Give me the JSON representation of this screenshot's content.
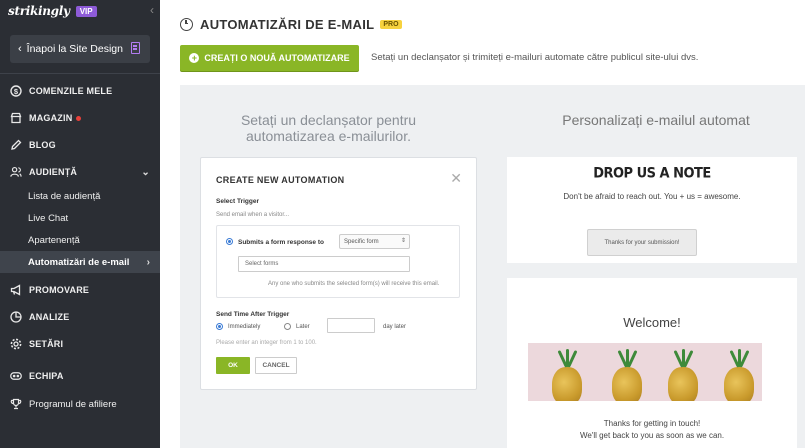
{
  "sidebar": {
    "logo": "strikingly",
    "badge": "VIP",
    "back_label": "Înapoi la Site Design",
    "items": [
      {
        "label": "COMENZILE MELE"
      },
      {
        "label": "MAGAZIN"
      },
      {
        "label": "BLOG"
      },
      {
        "label": "AUDIENȚĂ"
      },
      {
        "label": "Lista de audiență"
      },
      {
        "label": "Live Chat"
      },
      {
        "label": "Apartenență"
      },
      {
        "label": "Automatizări de e-mail"
      },
      {
        "label": "PROMOVARE"
      },
      {
        "label": "ANALIZE"
      },
      {
        "label": "SETĂRI"
      },
      {
        "label": "ECHIPA"
      },
      {
        "label": "Programul de afiliere"
      }
    ]
  },
  "header": {
    "title": "AUTOMATIZĂRI DE E-MAIL",
    "badge": "PRO"
  },
  "toolbar": {
    "create_label": "CREAȚI O NOUĂ AUTOMATIZARE",
    "description": "Setați un declanșator și trimiteți e-mailuri automate către publicul site-ului dvs."
  },
  "left_panel": {
    "heading": "Setați un declanșator pentru automatizarea e-mailurilor."
  },
  "modal": {
    "title": "CREATE NEW AUTOMATION",
    "select_trigger_label": "Select Trigger",
    "send_when_hint": "Send email when a visitor...",
    "form_response_label": "Submits a form response to",
    "select_value": "Specific form",
    "forms_placeholder": "Select forms",
    "forms_hint": "Any one who submits the selected form(s) will receive this email.",
    "send_time_label": "Send Time After Trigger",
    "immediately_label": "Immediately",
    "later_label": "Later",
    "days_later_label": "day later",
    "integer_hint": "Please enter an integer from 1 to 100.",
    "ok_label": "OK",
    "cancel_label": "CANCEL"
  },
  "right_panel": {
    "heading": "Personalizați e-mailul automat",
    "card1": {
      "title": "DROP US A NOTE",
      "subtitle": "Don't be afraid to reach out. You + us = awesome.",
      "button": "Thanks for your submission!"
    },
    "card2": {
      "title": "Welcome!",
      "line1": "Thanks for getting in touch!",
      "line2": "We'll get back to you as soon as we can."
    }
  },
  "colors": {
    "sidebar_bg": "#2b2e34",
    "accent_green": "#8ab626",
    "vip_purple": "#8e5bd8",
    "pro_yellow": "#f7d23e"
  }
}
